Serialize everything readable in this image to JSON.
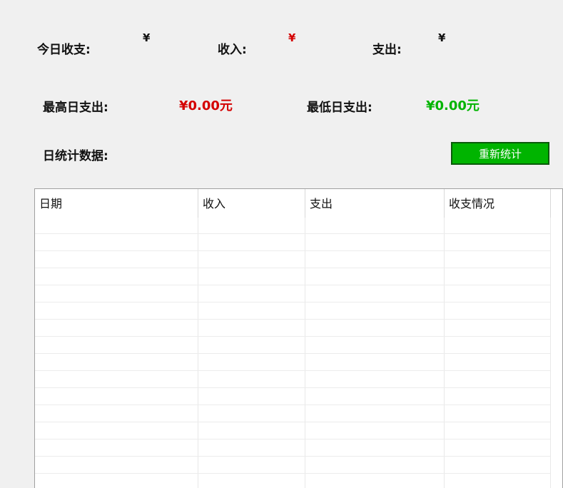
{
  "summary": {
    "today_label": "今日收支:",
    "today_currency": "¥",
    "income_label": "收入:",
    "income_currency": "¥",
    "expense_label": "支出:",
    "expense_currency": "¥",
    "max_expense_label": "最高日支出:",
    "max_expense_value": "¥0.00元",
    "min_expense_label": "最低日支出:",
    "min_expense_value": "¥0.00元",
    "stats_label": "日统计数据:"
  },
  "button": {
    "recalc_label": "重新统计"
  },
  "table": {
    "columns": [
      "日期",
      "收入",
      "支出",
      "收支情况"
    ],
    "rows": []
  },
  "colors": {
    "income_red": "#d40000",
    "green": "#00b400"
  }
}
